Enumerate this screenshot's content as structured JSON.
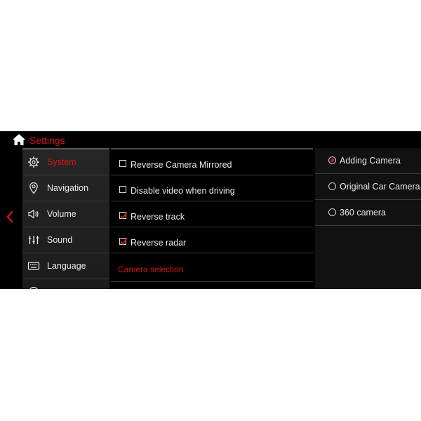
{
  "header": {
    "title": "Settings",
    "home_icon": "home-icon"
  },
  "back": {
    "icon": "chevron-left-icon"
  },
  "sidebar": {
    "items": [
      {
        "label": "System",
        "icon": "gear-icon",
        "active": true
      },
      {
        "label": "Navigation",
        "icon": "map-pin-icon",
        "active": false
      },
      {
        "label": "Volume",
        "icon": "speaker-icon",
        "active": false
      },
      {
        "label": "Sound",
        "icon": "equalizer-icon",
        "active": false
      },
      {
        "label": "Language",
        "icon": "keyboard-icon",
        "active": false
      }
    ]
  },
  "options": [
    {
      "label": "Reverse Camera Mirrored",
      "checked": false
    },
    {
      "label": "Disable video when driving",
      "checked": false
    },
    {
      "label": "Reverse track",
      "checked": true
    },
    {
      "label": "Reverse radar",
      "checked": true
    }
  ],
  "section": {
    "camera_selection": "Camera selection"
  },
  "camera_options": [
    {
      "label": "Adding Camera",
      "selected": true
    },
    {
      "label": "Original Car Camera",
      "selected": false
    },
    {
      "label": "360 camera",
      "selected": false
    }
  ],
  "colors": {
    "accent": "#d3141b",
    "background": "#000000",
    "sidebar": "#222222",
    "text": "#e8e8e8"
  }
}
